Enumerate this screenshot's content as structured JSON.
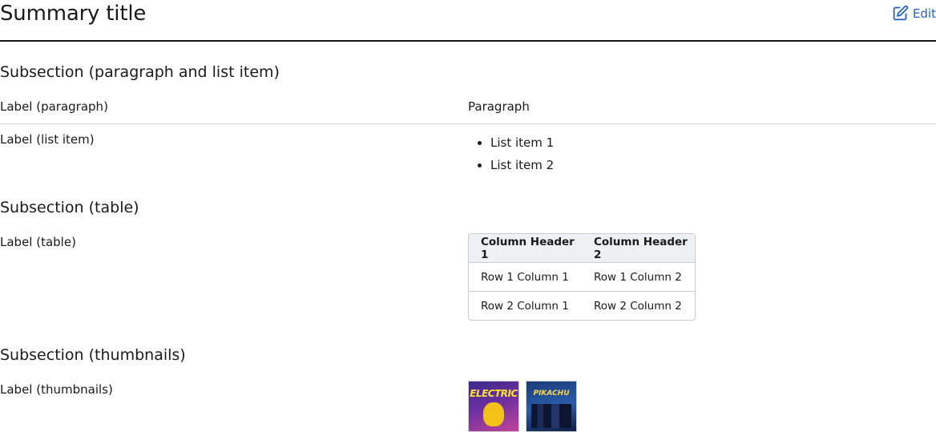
{
  "header": {
    "title": "Summary title",
    "edit_label": "Edit"
  },
  "sections": {
    "paragraph_list": {
      "heading": "Subsection (paragraph and list item)",
      "paragraph_label": "Label (paragraph)",
      "paragraph_value": "Paragraph",
      "list_label": "Label (list item)",
      "list_items": [
        "List item 1",
        "List item 2"
      ]
    },
    "table": {
      "heading": "Subsection (table)",
      "label": "Label (table)",
      "headers": [
        "Column Header 1",
        "Column Header 2"
      ],
      "rows": [
        [
          "Row 1 Column 1",
          "Row 1 Column 2"
        ],
        [
          "Row 2 Column 1",
          "Row 2 Column 2"
        ]
      ]
    },
    "thumbnails": {
      "heading": "Subsection (thumbnails)",
      "label": "Label (thumbnails)",
      "thumb1_text": "ELECTRIC",
      "thumb2_text": "PIKACHU"
    }
  },
  "colors": {
    "link": "#1f5fbf",
    "divider": "#d9d9d9",
    "table_header_bg": "#eef0f3"
  },
  "icons": {
    "edit": "pencil-square-icon"
  }
}
